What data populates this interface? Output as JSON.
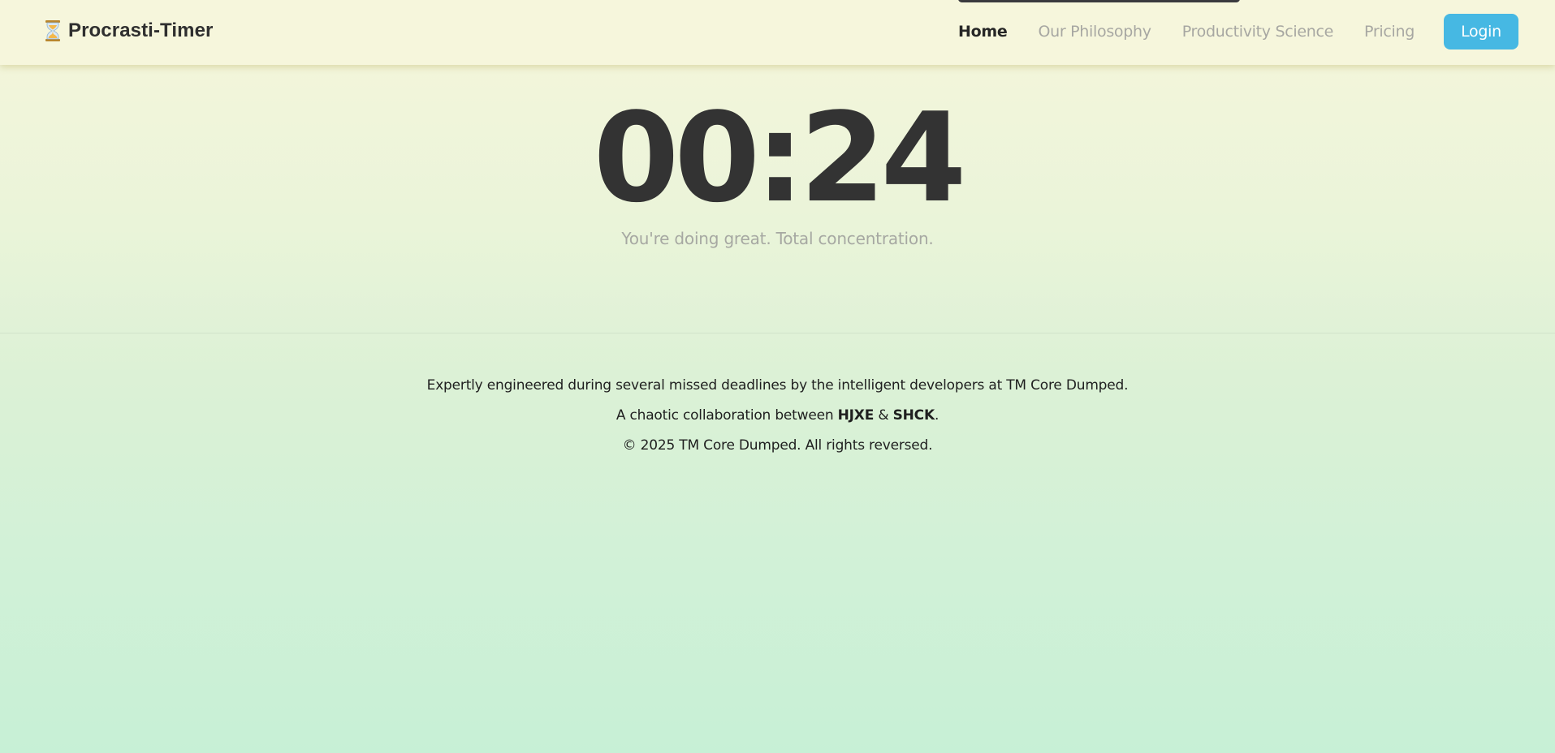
{
  "brand": {
    "icon": "hourglass-icon",
    "name": "Procrasti-Timer"
  },
  "nav": {
    "links": [
      {
        "label": "Home",
        "active": true
      },
      {
        "label": "Our Philosophy",
        "active": false
      },
      {
        "label": "Productivity Science",
        "active": false
      },
      {
        "label": "Pricing",
        "active": false
      }
    ],
    "login_label": "Login"
  },
  "timer": {
    "display": "00:24",
    "tagline": "You're doing great. Total concentration."
  },
  "footer": {
    "line1": "Expertly engineered during several missed deadlines by the intelligent developers at TM Core Dumped.",
    "line2_prefix": "A chaotic collaboration between ",
    "author1": "HJXE",
    "line2_mid": " & ",
    "author2": "SHCK",
    "line2_suffix": ".",
    "line3": "© 2025 TM Core Dumped. All rights reversed."
  },
  "colors": {
    "accent": "#46b8e3",
    "text_dark": "#333333",
    "text_muted": "#a7a7a2",
    "nav_bg": "#f6f6dc",
    "bg_top": "#f6f6db",
    "bg_bottom": "#c7f0d6"
  }
}
